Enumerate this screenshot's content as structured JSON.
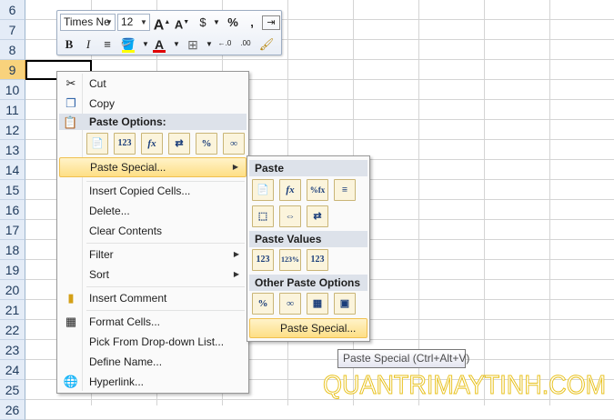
{
  "rows": [
    "6",
    "7",
    "8",
    "9",
    "10",
    "11",
    "12",
    "13",
    "14",
    "15",
    "16",
    "17",
    "18",
    "19",
    "20",
    "21",
    "22",
    "23",
    "24",
    "25",
    "26"
  ],
  "minitoolbar": {
    "font": "Times Ne",
    "size": "12",
    "grow_font": "A",
    "shrink_font": "A",
    "currency": "$",
    "percent": "%",
    "comma": ",",
    "bold": "B",
    "italic": "I",
    "font_color": "A",
    "inc_decimal": "←.0",
    "dec_decimal": ".00"
  },
  "context_menu": {
    "cut": "Cut",
    "copy": "Copy",
    "paste_options": "Paste Options:",
    "paste_special": "Paste Special...",
    "insert_copied": "Insert Copied Cells...",
    "delete": "Delete...",
    "clear": "Clear Contents",
    "filter": "Filter",
    "sort": "Sort",
    "insert_comment": "Insert Comment",
    "format_cells": "Format Cells...",
    "pick_list": "Pick From Drop-down List...",
    "define_name": "Define Name...",
    "hyperlink": "Hyperlink...",
    "paste_icons": [
      "📄",
      "123",
      "fx",
      "⇄",
      "%",
      "∞"
    ]
  },
  "submenu": {
    "paste": "Paste",
    "paste_values": "Paste Values",
    "other": "Other Paste Options",
    "paste_special": "Paste Special...",
    "paste_icons": [
      "📄",
      "fx",
      "%fx",
      "≡",
      "⬚",
      "⇔",
      "⇄"
    ],
    "value_icons": [
      "123",
      "123%",
      "123"
    ],
    "other_icons": [
      "%",
      "∞",
      "▦",
      "▣"
    ]
  },
  "tooltip": "Paste Special (Ctrl+Alt+V)",
  "watermark": "QUANTRIMAYTINH.COM"
}
